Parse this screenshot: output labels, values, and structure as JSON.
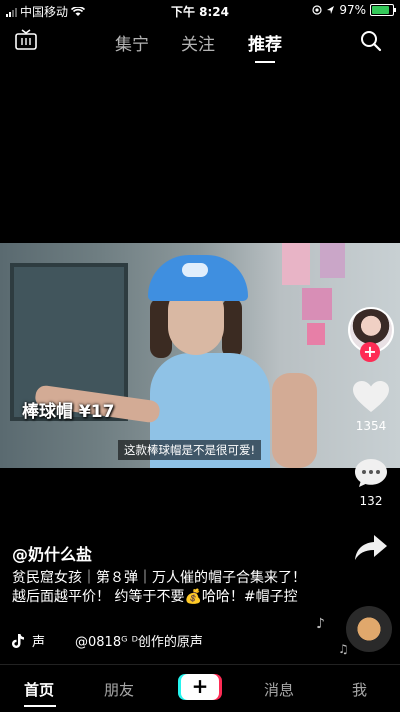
{
  "status_bar": {
    "carrier": "中国移动",
    "time": "下午 8:24",
    "battery": "97%",
    "battery_level": 0.97
  },
  "top_nav": {
    "live_icon": "live-tv-icon",
    "tabs": [
      {
        "label": "集宁",
        "active": false
      },
      {
        "label": "关注",
        "active": false
      },
      {
        "label": "推荐",
        "active": true
      }
    ],
    "search_icon": "search-icon"
  },
  "video": {
    "caption_tag": "棒球帽 ¥17",
    "subtitle": "这款棒球帽是不是很可爱!"
  },
  "actions": {
    "like_count": "1354",
    "comment_count": "132"
  },
  "post": {
    "author": "@奶什么盐",
    "description": "贫民窟女孩｜第８弹｜万人催的帽子合集来了！越后面越平价！ 约等于不要💰哈哈！#帽子控",
    "music_label": "声",
    "music_track": "@0818ᴳ ᴰ创作的原声"
  },
  "bottom_nav": {
    "items": [
      {
        "label": "首页",
        "active": true
      },
      {
        "label": "朋友",
        "active": false
      },
      {
        "label": "+",
        "active": false
      },
      {
        "label": "消息",
        "active": false
      },
      {
        "label": "我",
        "active": false
      }
    ]
  },
  "colors": {
    "accent": "#fe2c55",
    "cyan": "#25f4ee",
    "battery_green": "#34c759"
  }
}
